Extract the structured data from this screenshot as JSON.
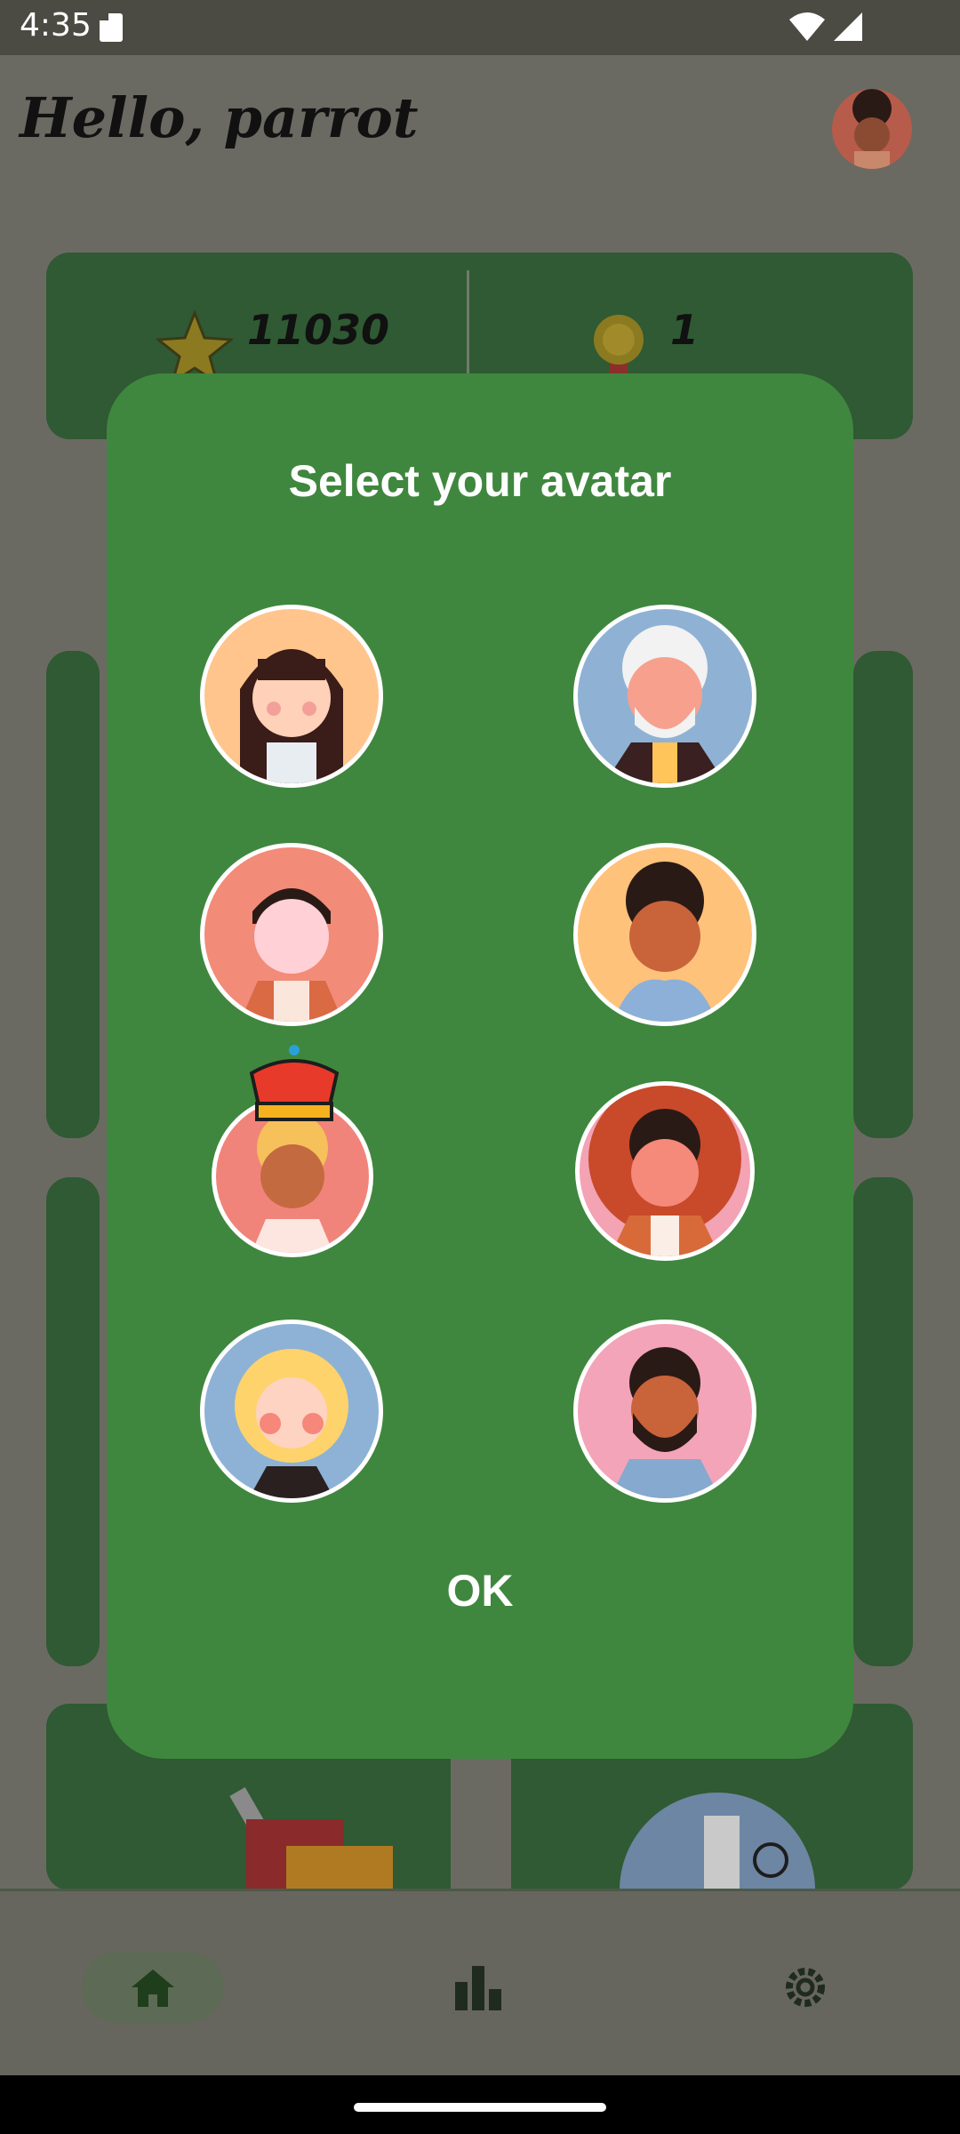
{
  "status_bar": {
    "time": "4:35"
  },
  "header": {
    "greeting": "Hello, parrot"
  },
  "stats": {
    "points_value": "11030",
    "medals_value": "1"
  },
  "dialog": {
    "title": "Select your avatar",
    "ok_label": "OK",
    "avatars": [
      {
        "name": "avatar-girl-bangs",
        "bg": "#ffc58d"
      },
      {
        "name": "avatar-old-man",
        "bg": "#8fb2d4"
      },
      {
        "name": "avatar-man-dark-hair",
        "bg": "#f28b78"
      },
      {
        "name": "avatar-curly-man",
        "bg": "#ffc27a"
      },
      {
        "name": "avatar-woman-crown",
        "bg": "#f1847a"
      },
      {
        "name": "avatar-red-curly-man",
        "bg": "#f3a3b3"
      },
      {
        "name": "avatar-blonde-woman",
        "bg": "#8db2d6"
      },
      {
        "name": "avatar-bearded-man",
        "bg": "#f3a4b8"
      }
    ]
  },
  "nav": {
    "items": [
      "home-icon",
      "leaderboard-icon",
      "settings-icon"
    ]
  },
  "colors": {
    "dialog_bg": "#3f873e",
    "scrim_bg": "#6b6a62",
    "card_bg": "#2f5a33"
  }
}
